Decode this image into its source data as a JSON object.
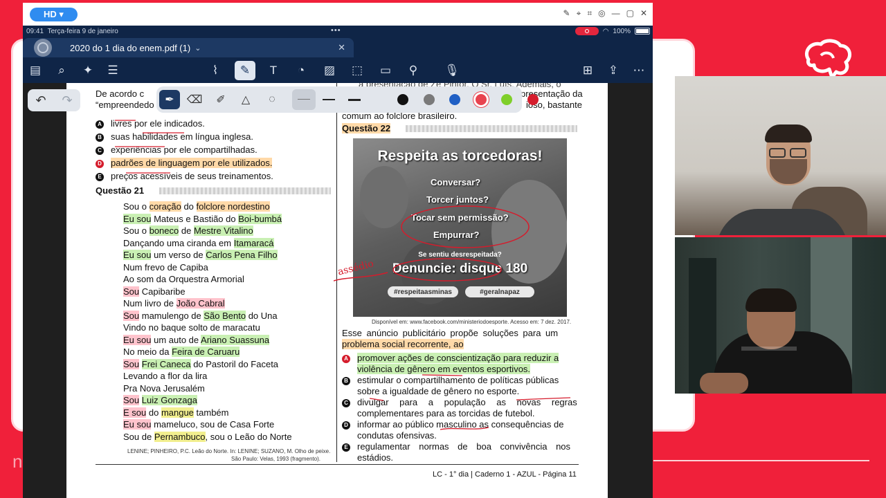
{
  "titlebar": {
    "hd_label": "HD ▾"
  },
  "status": {
    "time": "09:41",
    "date": "Terça-feira 9 de janeiro",
    "battery": "100%"
  },
  "tab": {
    "title": "2020 do 1 dia do enem.pdf (1)",
    "chevron": "⌄"
  },
  "page": {
    "left": {
      "intro_line1": "De acordo c",
      "intro_line2": "“empreendedo",
      "options": [
        {
          "letter": "A",
          "text": "livres por ele indicados."
        },
        {
          "letter": "B",
          "text": "suas habilidades em língua inglesa."
        },
        {
          "letter": "C",
          "text": "experiências por ele compartilhadas."
        },
        {
          "letter": "D",
          "text": "padrões de linguagem por ele utilizados."
        },
        {
          "letter": "E",
          "text": "preços acessíveis de seus treinamentos."
        }
      ],
      "q21_title": "Questão 21",
      "poem": [
        "Sou o coração do folclore nordestino",
        "Eu sou Mateus e Bastião do Boi-bumbá",
        "Sou o boneco de Mestre Vitalino",
        "Dançando uma ciranda em Itamaracá",
        "Eu sou um verso de Carlos Pena Filho",
        "Num frevo de Capiba",
        "Ao som da Orquestra Armorial",
        "Sou Capibaribe",
        "Num livro de João Cabral",
        "Sou mamulengo de São Bento do Una",
        "Vindo no baque solto de maracatu",
        "Eu sou um auto de Ariano Suassuna",
        "No meio da Feira de Caruaru",
        "Sou Frei Caneca do Pastoril do Faceta",
        "Levando a flor da lira",
        "Pra Nova Jerusalém",
        "Sou Luiz Gonzaga",
        "E sou do mangue também",
        "Eu sou mameluco, sou de Casa Forte",
        "Sou de Pernambuco, sou o Leão do Norte"
      ],
      "citation1": "LENINE; PINHEIRO, P.C. Leão do Norte. In: LENINE; SUZANO, M. Olho de peixe.",
      "citation2": "São Paulo: Velas, 1993 (fragmento)."
    },
    "right": {
      "top_line1": "a presentação de Zé Pintor. O Sr. Luís. Ademais, o",
      "top_line1_end": "presentação da",
      "top_line2_end": "ioso, bastante",
      "top_line3": "comum ao folclore brasileiro.",
      "q22_title": "Questão 22",
      "poster": {
        "title": "Respeita as torcedoras!",
        "items": [
          "Conversar?",
          "Torcer juntos?",
          "Tocar sem permissão?",
          "Empurrar?"
        ],
        "sub": "Se sentiu desrespeitada?",
        "big": "Denuncie: disque 180",
        "tag1": "#respeitaasminas",
        "tag2": "#geralnapaz"
      },
      "source": "Disponível em: www.facebook.com/ministeriodoesporte. Acesso em: 7 dez. 2017.",
      "stem_line1": "Esse anúncio publicitário propõe soluções para um",
      "stem_line2": "problema social recorrente, ao",
      "options": [
        {
          "letter": "A",
          "line1": "promover ações de conscientização para reduzir a",
          "line2": "violência de gênero em eventos esportivos."
        },
        {
          "letter": "B",
          "line1": "estimular o compartilhamento de políticas públicas",
          "line2": "sobre a igualdade de gênero no esporte."
        },
        {
          "letter": "C",
          "line1": "divulgar para a população as novas regras",
          "line2": "complementares para as torcidas de futebol."
        },
        {
          "letter": "D",
          "line1": "informar ao público masculino as consequências de",
          "line2": "condutas ofensivas."
        },
        {
          "letter": "E",
          "line1": "regulamentar normas de boa convivência nos",
          "line2": "estádios."
        }
      ],
      "handwriting": "assédio"
    },
    "footer": "LC - 1° dia | Caderno 1 - AZUL - Página 11"
  },
  "colors": {
    "accent": "#f0203a",
    "app_dark": "#0f2547",
    "tab_bg": "#1d3963",
    "palette": [
      "#111111",
      "#7a7a7a",
      "#1f5fc4",
      "#e8434f",
      "#7fcf2a",
      "#d51c2c"
    ]
  }
}
